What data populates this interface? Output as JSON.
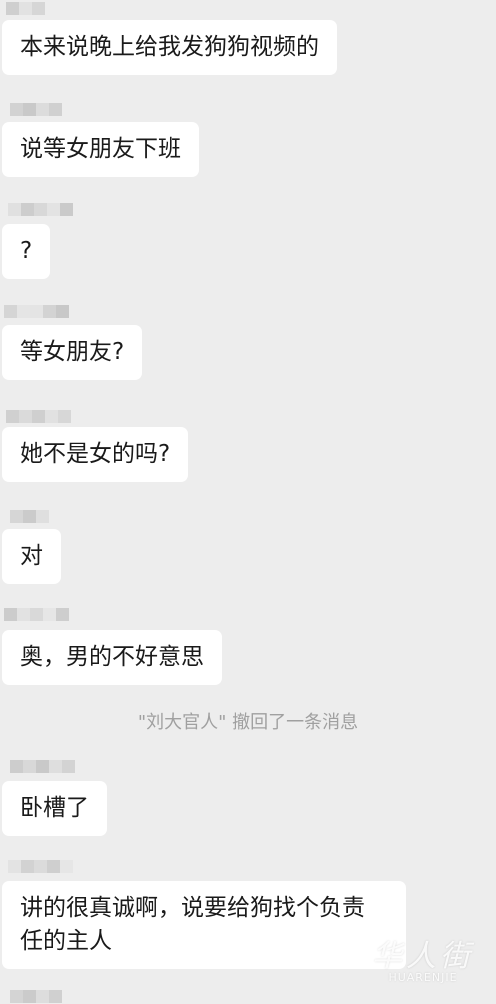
{
  "messages": [
    {
      "text": "本来说晚上给我发狗狗视频的"
    },
    {
      "text": "说等女朋友下班"
    },
    {
      "text": "?"
    },
    {
      "text": "等女朋友?"
    },
    {
      "text": "她不是女的吗?"
    },
    {
      "text": "对"
    },
    {
      "text": "奥，男的不好意思"
    },
    {
      "text": "卧槽了"
    },
    {
      "text": "讲的很真诚啊，说要给狗找个负责\n任的主人"
    }
  ],
  "system_notice": "\"刘大官人\" 撤回了一条消息",
  "watermark": {
    "main": "华人街",
    "sub": "HUARENJIE"
  },
  "colors": {
    "background": "#ededed",
    "bubble": "#ffffff",
    "text": "#1a1a1a",
    "notice": "#a0a0a0"
  }
}
